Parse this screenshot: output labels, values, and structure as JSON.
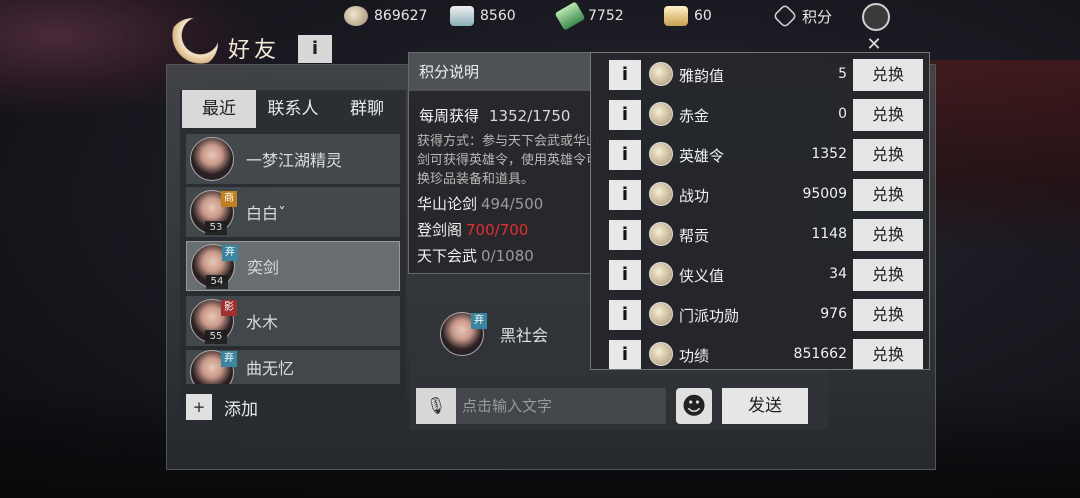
{
  "topbar": {
    "resources": [
      {
        "icon": "coin-icon",
        "value": "869627"
      },
      {
        "icon": "silver-ingot-icon",
        "value": "8560"
      },
      {
        "icon": "jade-icon",
        "value": "7752"
      },
      {
        "icon": "gold-ingot-icon",
        "value": "60"
      }
    ],
    "points_label": "积分"
  },
  "friends": {
    "title": "好友",
    "info_label": "i",
    "tabs": [
      {
        "label": "最近",
        "active": true
      },
      {
        "label": "联系人",
        "active": false
      },
      {
        "label": "群聊",
        "active": false
      }
    ],
    "contacts": [
      {
        "name": "一梦江湖精灵",
        "level": "",
        "badge": ""
      },
      {
        "name": "白白ˇ",
        "level": "53",
        "badge": "商"
      },
      {
        "name": "奕剑",
        "level": "54",
        "badge": "弃"
      },
      {
        "name": "水木",
        "level": "55",
        "badge": "影"
      },
      {
        "name": "曲无忆",
        "level": "",
        "badge": "弃"
      }
    ],
    "add_icon": "+",
    "add_label": "添加"
  },
  "chat": {
    "message_sender": "黑社会",
    "message_sender_badge": "弃",
    "mic_icon": "🎙",
    "input_placeholder": "点击输入文字",
    "emoji_icon": "☻",
    "send_label": "发送"
  },
  "tooltip": {
    "title": "积分说明",
    "weekly_label": "每周获得",
    "weekly_value": "1352/1750",
    "description": "获得方式：参与天下会武或华山论剑可获得英雄令，使用英雄令可兑换珍品装备和道具。",
    "lines": [
      {
        "label": "华山论剑",
        "value": "494/500",
        "highlight": false
      },
      {
        "label": "登剑阁",
        "value": "700/700",
        "highlight": true
      },
      {
        "label": "天下会武",
        "value": "0/1080",
        "highlight": false
      }
    ]
  },
  "points": {
    "exchange_label": "兑换",
    "info_label": "i",
    "rows": [
      {
        "name": "雅韵值",
        "value": "5",
        "icon": "lotus-icon",
        "has_info": true
      },
      {
        "name": "赤金",
        "value": "0",
        "icon": "gold-bars-icon",
        "has_info": true
      },
      {
        "name": "英雄令",
        "value": "1352",
        "icon": "hero-token-icon",
        "has_info": true
      },
      {
        "name": "战功",
        "value": "95009",
        "icon": "battle-merit-icon",
        "has_info": true
      },
      {
        "name": "帮贡",
        "value": "1148",
        "icon": "guild-contribution-icon",
        "has_info": true
      },
      {
        "name": "侠义值",
        "value": "34",
        "icon": "chivalry-gourd-icon",
        "has_info": true
      },
      {
        "name": "门派功勋",
        "value": "976",
        "icon": "sect-merit-icon",
        "has_info": true
      },
      {
        "name": "功绩",
        "value": "851662",
        "icon": "achievement-icon",
        "has_info": true
      }
    ]
  },
  "colors": {
    "highlight_red": "#e03030",
    "button_bg": "#e6e6e6"
  }
}
